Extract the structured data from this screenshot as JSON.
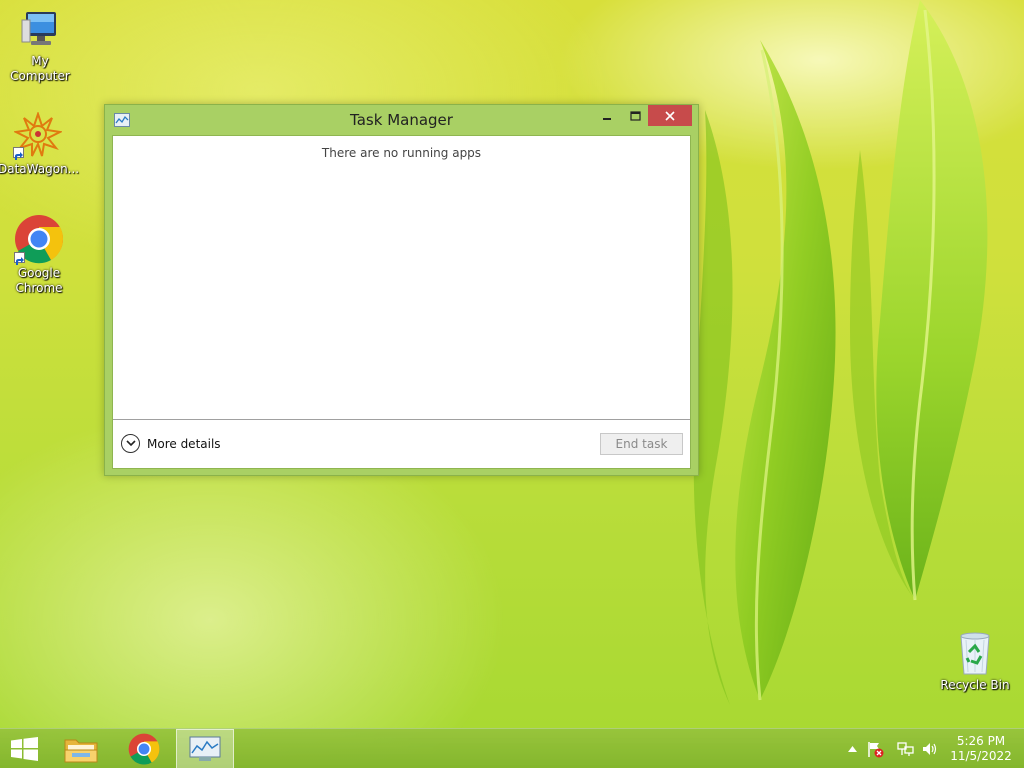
{
  "desktop": {
    "icons": [
      {
        "label": "My Computer",
        "icon": "computer-icon"
      },
      {
        "label": "DataWagon...",
        "icon": "datawagon-icon"
      },
      {
        "label": "Google Chrome",
        "icon": "chrome-icon"
      },
      {
        "label": "Recycle Bin",
        "icon": "recycle-bin-icon"
      }
    ]
  },
  "window": {
    "title": "Task Manager",
    "empty_message": "There are no running apps",
    "more_details_label": "More details",
    "end_task_label": "End task",
    "end_task_enabled": false
  },
  "taskbar": {
    "items": [
      {
        "name": "start",
        "icon": "windows-logo-icon"
      },
      {
        "name": "file-explorer",
        "icon": "folder-icon"
      },
      {
        "name": "google-chrome",
        "icon": "chrome-icon"
      },
      {
        "name": "task-manager",
        "icon": "task-manager-icon",
        "active": true
      }
    ],
    "tray": {
      "icons": [
        "show-hidden-icons",
        "action-center-flag-icon",
        "network-icon",
        "volume-icon"
      ],
      "time": "5:26 PM",
      "date": "11/5/2022"
    }
  },
  "colors": {
    "window_frame": "#a9d064",
    "close_button": "#c74b4b",
    "taskbar": "#8cbc3c"
  }
}
